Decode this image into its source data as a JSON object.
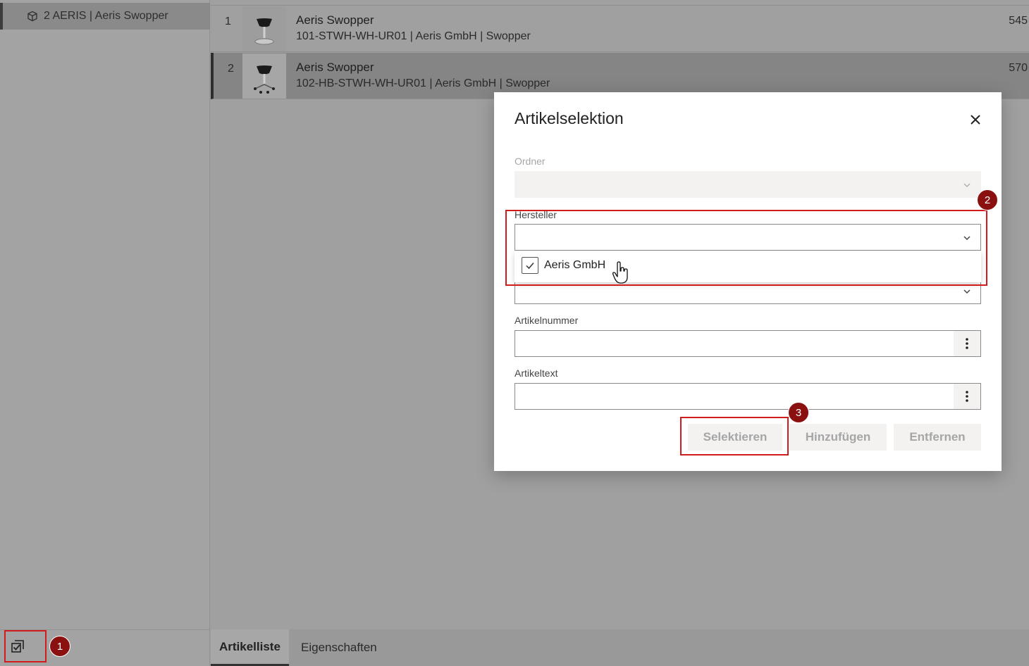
{
  "sidebar": {
    "tree_item": "2 AERIS | Aeris Swopper",
    "tree_item_icon": "cube-icon",
    "footer_icon": "selection-checklist-icon"
  },
  "badges": {
    "b1": "1",
    "b2": "2",
    "b3": "3"
  },
  "article_list": {
    "rows": [
      {
        "num": "1",
        "title": "Aeris Swopper",
        "sub": "101-STWH-WH-UR01 | Aeris GmbH | Swopper",
        "price": "545"
      },
      {
        "num": "2",
        "title": "Aeris Swopper",
        "sub": "102-HB-STWH-WH-UR01 | Aeris GmbH | Swopper",
        "price": "570"
      }
    ]
  },
  "tabs": {
    "t1": "Artikelliste",
    "t2": "Eigenschaften"
  },
  "dialog": {
    "title": "Artikelselektion",
    "close_icon": "close-icon",
    "ordner_label": "Ordner",
    "hersteller_label": "Hersteller",
    "hersteller_option": "Aeris GmbH",
    "artikelnummer_label": "Artikelnummer",
    "artikeltext_label": "Artikeltext",
    "btn_selektieren": "Selektieren",
    "btn_hinzufuegen": "Hinzufügen",
    "btn_entfernen": "Entfernen"
  },
  "colors": {
    "highlight": "#d01c1c",
    "badge": "#8b1010"
  }
}
